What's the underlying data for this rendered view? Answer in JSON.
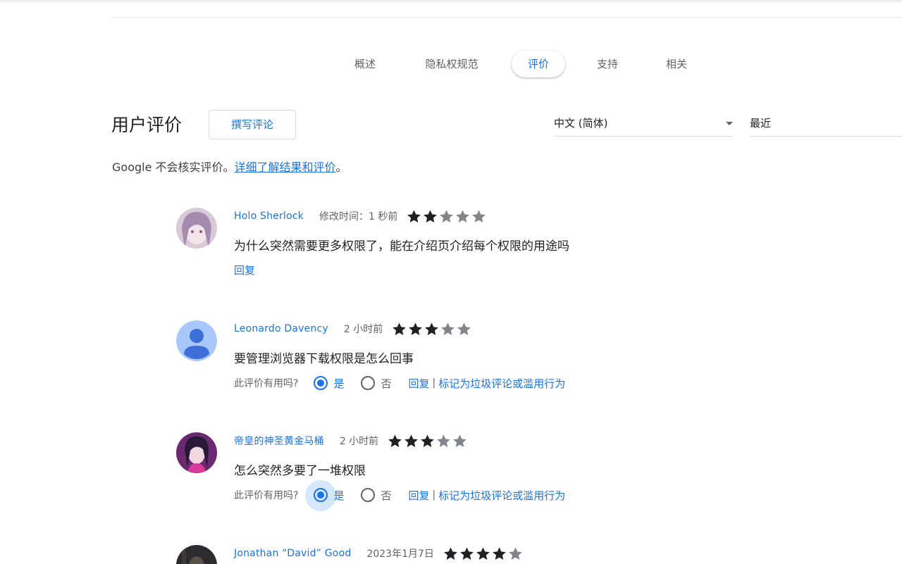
{
  "tabs": [
    {
      "label": "概述",
      "active": false
    },
    {
      "label": "隐私权规范",
      "active": false
    },
    {
      "label": "评价",
      "active": true
    },
    {
      "label": "支持",
      "active": false
    },
    {
      "label": "相关",
      "active": false
    }
  ],
  "reviews_section": {
    "title": "用户评价",
    "write_button": "撰写评论",
    "language_select": "中文 (简体)",
    "sort_select": "最近",
    "disclaimer_prefix": "Google 不会核实评价。",
    "disclaimer_link": "详细了解结果和评价",
    "disclaimer_suffix": "。"
  },
  "reviews": [
    {
      "author": "Holo Sherlock",
      "time": "修改时间：1 秒前",
      "rating": 2,
      "text": "为什么突然需要更多权限了，能在介绍页介绍每个权限的用途吗",
      "reply": "回复"
    },
    {
      "author": "Leonardo Davency",
      "time": "2 小时前",
      "rating": 3,
      "text": "要管理浏览器下载权限是怎么回事",
      "helpful_question": "此评价有用吗?",
      "yes": "是",
      "no": "否",
      "reply": "回复",
      "report": "标记为垃圾评论或滥用行为",
      "selected": "yes"
    },
    {
      "author": "帝皇的神圣黄金马桶",
      "time": "2 小时前",
      "rating": 3,
      "text": "怎么突然多要了一堆权限",
      "helpful_question": "此评价有用吗?",
      "yes": "是",
      "no": "否",
      "reply": "回复",
      "report": "标记为垃圾评论或滥用行为",
      "selected": "yes"
    },
    {
      "author": "Jonathan “David” Good",
      "time": "2023年1月7日",
      "rating": 4
    }
  ],
  "colors": {
    "accent": "#1a73e8",
    "star_filled": "#202124",
    "star_empty": "#80868b"
  }
}
